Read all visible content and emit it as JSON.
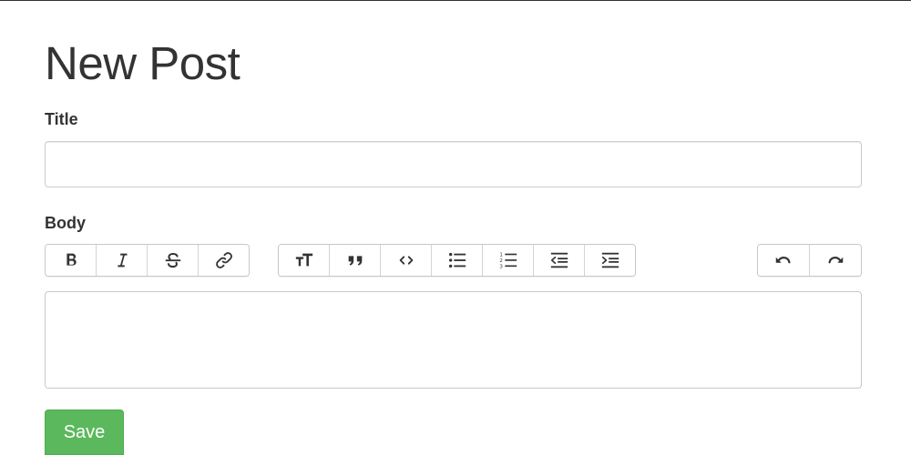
{
  "page": {
    "heading": "New Post",
    "accent_color": "#5cb85c"
  },
  "form": {
    "title_label": "Title",
    "title_value": "",
    "title_placeholder": "",
    "body_label": "Body",
    "body_value": "",
    "save_label": "Save"
  },
  "toolbar": {
    "groups": [
      {
        "name": "text-style",
        "buttons": [
          "bold-icon",
          "italic-icon",
          "strikethrough-icon",
          "link-icon"
        ]
      },
      {
        "name": "block",
        "buttons": [
          "heading-icon",
          "quote-icon",
          "code-icon",
          "bullet-list-icon",
          "numbered-list-icon",
          "outdent-icon",
          "indent-icon"
        ]
      },
      {
        "name": "history",
        "buttons": [
          "undo-icon",
          "redo-icon"
        ]
      }
    ]
  }
}
